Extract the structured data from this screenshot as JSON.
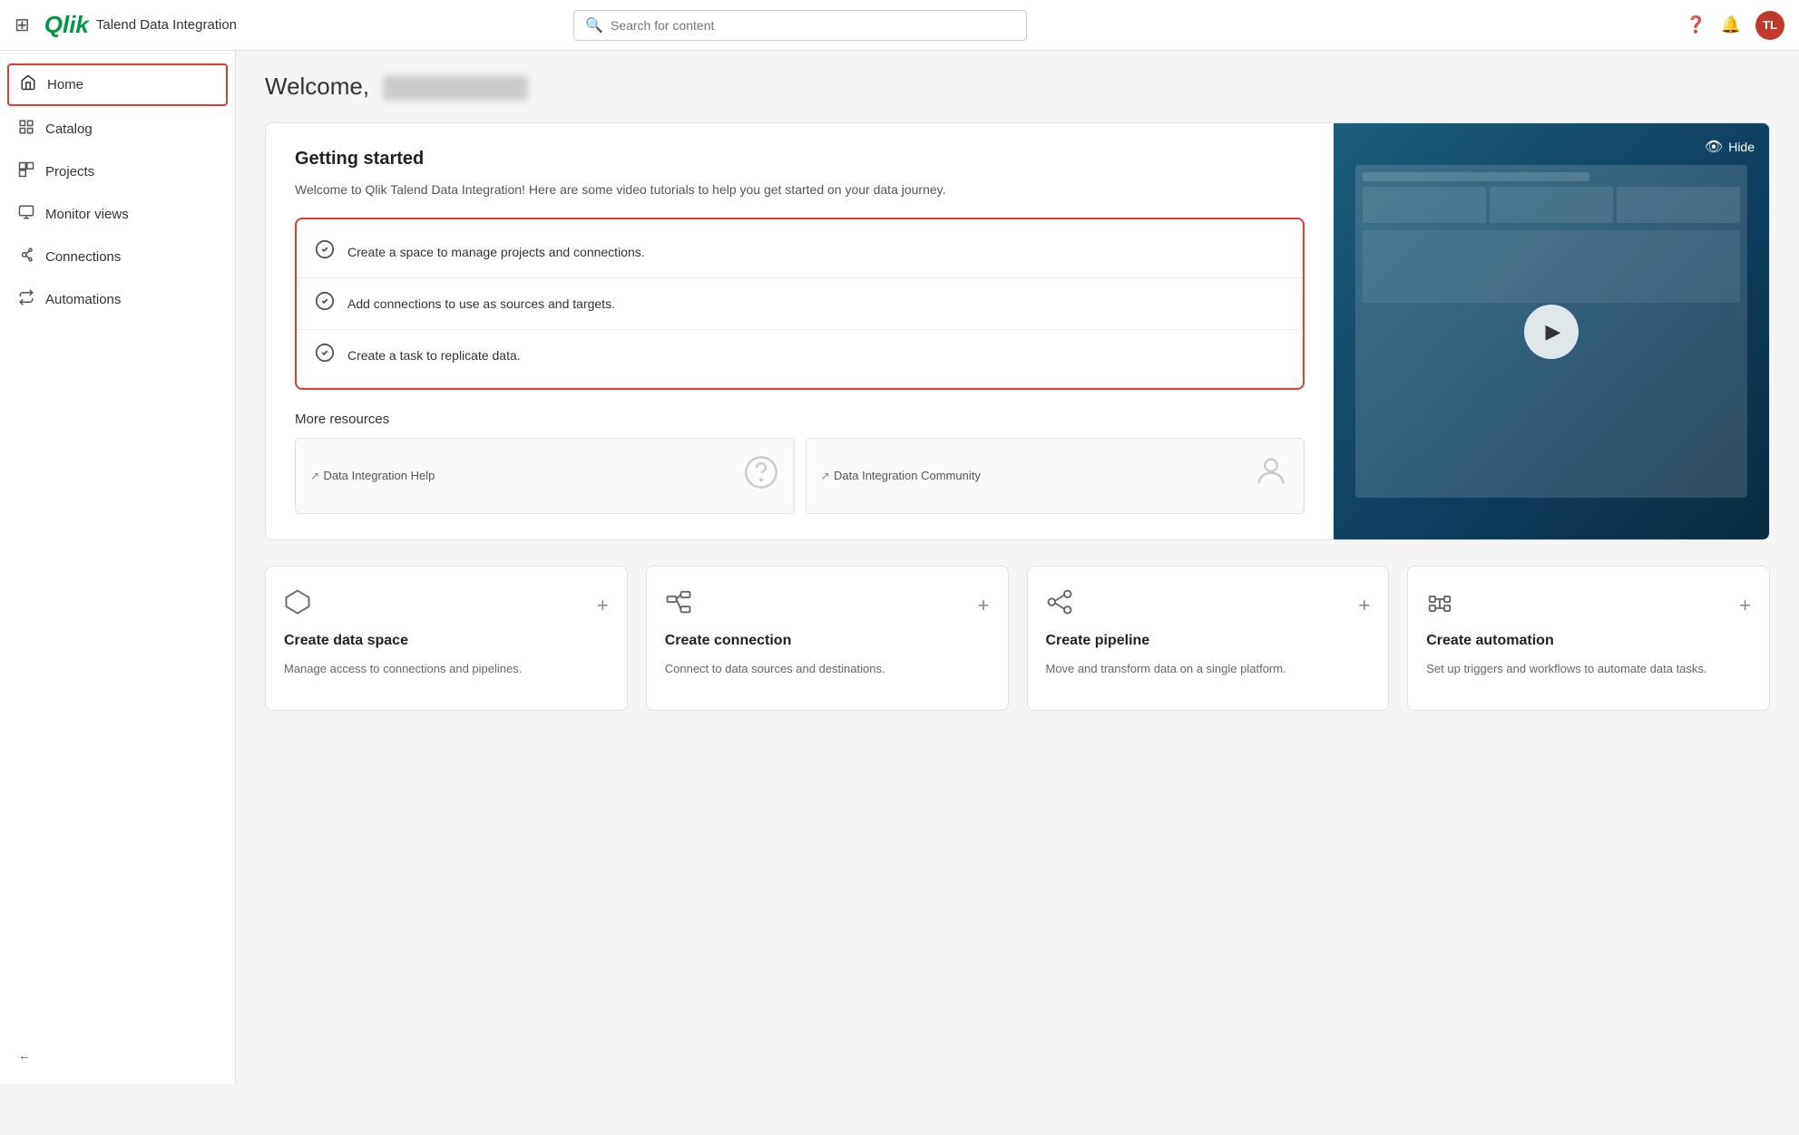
{
  "topnav": {
    "logo_text": "Qlik",
    "app_name": "Talend Data Integration",
    "search_placeholder": "Search for content",
    "help_icon": "?",
    "avatar_text": "TL"
  },
  "sidebar": {
    "items": [
      {
        "id": "home",
        "label": "Home",
        "icon": "🏠",
        "active": true
      },
      {
        "id": "catalog",
        "label": "Catalog",
        "icon": "📋",
        "active": false
      },
      {
        "id": "projects",
        "label": "Projects",
        "icon": "📊",
        "active": false
      },
      {
        "id": "monitor-views",
        "label": "Monitor views",
        "icon": "📈",
        "active": false
      },
      {
        "id": "connections",
        "label": "Connections",
        "icon": "🔗",
        "active": false
      },
      {
        "id": "automations",
        "label": "Automations",
        "icon": "⚙",
        "active": false
      }
    ],
    "collapse_label": ""
  },
  "main": {
    "welcome_text": "Welcome,",
    "getting_started": {
      "title": "Getting started",
      "description": "Welcome to Qlik Talend Data Integration! Here are some video tutorials to help you get started on your data journey.",
      "checklist": [
        {
          "text": "Create a space to manage projects and connections."
        },
        {
          "text": "Add connections to use as sources and targets."
        },
        {
          "text": "Create a task to replicate data."
        }
      ],
      "more_resources_title": "More resources",
      "resources": [
        {
          "label": "Data Integration Help",
          "icon": "ℹ"
        },
        {
          "label": "Data Integration Community",
          "icon": "👤"
        }
      ],
      "video_hide_label": "Hide"
    },
    "quick_actions": [
      {
        "id": "create-data-space",
        "title": "Create data space",
        "description": "Manage access to connections and pipelines.",
        "icon": "⬡",
        "plus": "+"
      },
      {
        "id": "create-connection",
        "title": "Create connection",
        "description": "Connect to data sources and destinations.",
        "icon": "⧉",
        "plus": "+"
      },
      {
        "id": "create-pipeline",
        "title": "Create pipeline",
        "description": "Move and transform data on a single platform.",
        "icon": "⬡",
        "plus": "+"
      },
      {
        "id": "create-automation",
        "title": "Create automation",
        "description": "Set up triggers and workflows to automate data tasks.",
        "icon": "⬛",
        "plus": "+"
      }
    ]
  }
}
